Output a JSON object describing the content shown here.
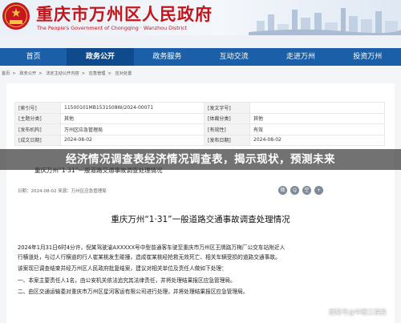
{
  "colors": {
    "brand_red": "#c3161c",
    "nav_blue": "#1a5fa8",
    "nav_active": "#0f4a8c",
    "banner_bg": "#3c3c3c"
  },
  "header": {
    "title": "重庆市万州区人民政府",
    "subtitle": "The People's Government of Chongqing · Wanzhou District",
    "emblem_icon": "national-emblem-icon"
  },
  "nav": {
    "items": [
      "首页",
      "政务公开",
      "政务服务",
      "互动交流",
      "走进万州",
      "投资万州"
    ],
    "active_index": 1
  },
  "breadcrumb": {
    "items": [
      "首页",
      "政务公开",
      "法定主动公开内容",
      "应急管理",
      "应对处置"
    ],
    "separator": ">"
  },
  "meta": {
    "rows": [
      {
        "k1": "[索引号]",
        "v1": "11500101MB1531508W/2024-00071",
        "k2": "[发文字号]",
        "v2": ""
      },
      {
        "k1": "[主题分类]",
        "v1": "其他",
        "k2": "[体裁分类]",
        "v2": "其他"
      },
      {
        "k1": "[发布机构]",
        "v1": "万州区应急管理局",
        "k2": "[有效性]",
        "v2": "有效"
      },
      {
        "k1": "[成文日期]",
        "v1": "2024-08-02",
        "k2": "[发布日期]",
        "v2": "2024-08-02"
      }
    ]
  },
  "doc": {
    "short_title": "重庆万州“1·31”一般道路交通事故调查处理情况",
    "date_source": "日期：2024-08-02   来源：万州区应急管理局",
    "title": "重庆万州“1·31”一般道路交通事故调查处理情况",
    "paragraphs": [
      "2024年1月31日6时4分许，倪某驾驶渝AXXXXX号中型普通客车驶至重庆市万州区王牌路万梅厂公交车站附近人",
      "行横道处，与过人行横道的行人崔某桃发生碰撞，造成崔某桃经抢救无效死亡、相关车辆受损的道路交通事故。",
      "该案现已调查结束并经万州区人民政府批复结案，建议对相关单位及责任人做如下处理：",
      "一、本案主要责任人1名，由公安机关依法追究其法律责任，并将处理结果报区应急管理局。",
      "二、由区交通运输委对重庆市万州区星河客运有限公司进行处理，并将处理结果报区应急管理局。"
    ]
  },
  "share": {
    "labels": [
      "微",
      "Q",
      "空",
      "+"
    ]
  },
  "banner": {
    "text": "经济情况调查表经济情况调查表，揭示现状，预测未来"
  },
  "watermark": {
    "text": "搜狐号@中国工程投"
  }
}
